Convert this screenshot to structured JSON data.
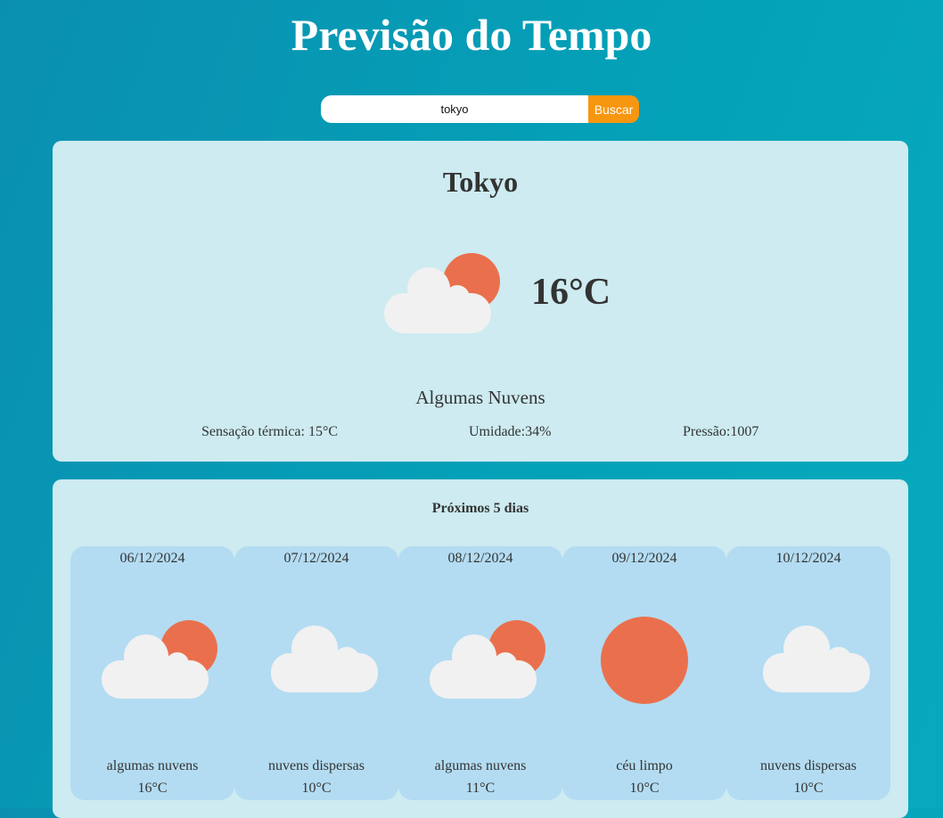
{
  "app": {
    "title": "Previsão do Tempo"
  },
  "search": {
    "value": "tokyo",
    "button_label": "Buscar"
  },
  "current": {
    "city": "Tokyo",
    "icon": "partly-cloudy-icon",
    "temperature": "16°C",
    "description": "Algumas Nuvens",
    "feels_like": "Sensação térmica: 15°C",
    "humidity": "Umidade:34%",
    "pressure": "Pressão:1007"
  },
  "forecast": {
    "title": "Próximos 5 dias",
    "days": [
      {
        "date": "06/12/2024",
        "icon": "partly-cloudy-icon",
        "description": "algumas nuvens",
        "temperature": "16°C"
      },
      {
        "date": "07/12/2024",
        "icon": "cloud-icon",
        "description": "nuvens dispersas",
        "temperature": "10°C"
      },
      {
        "date": "08/12/2024",
        "icon": "partly-cloudy-icon",
        "description": "algumas nuvens",
        "temperature": "11°C"
      },
      {
        "date": "09/12/2024",
        "icon": "sun-icon",
        "description": "céu limpo",
        "temperature": "10°C"
      },
      {
        "date": "10/12/2024",
        "icon": "cloud-icon",
        "description": "nuvens dispersas",
        "temperature": "10°C"
      }
    ]
  },
  "colors": {
    "sun": "#ea704d",
    "cloud": "#f1f1f1",
    "accent_button": "#f7960f",
    "card": "#cdebf0",
    "day_card": "#b3dcf2"
  }
}
